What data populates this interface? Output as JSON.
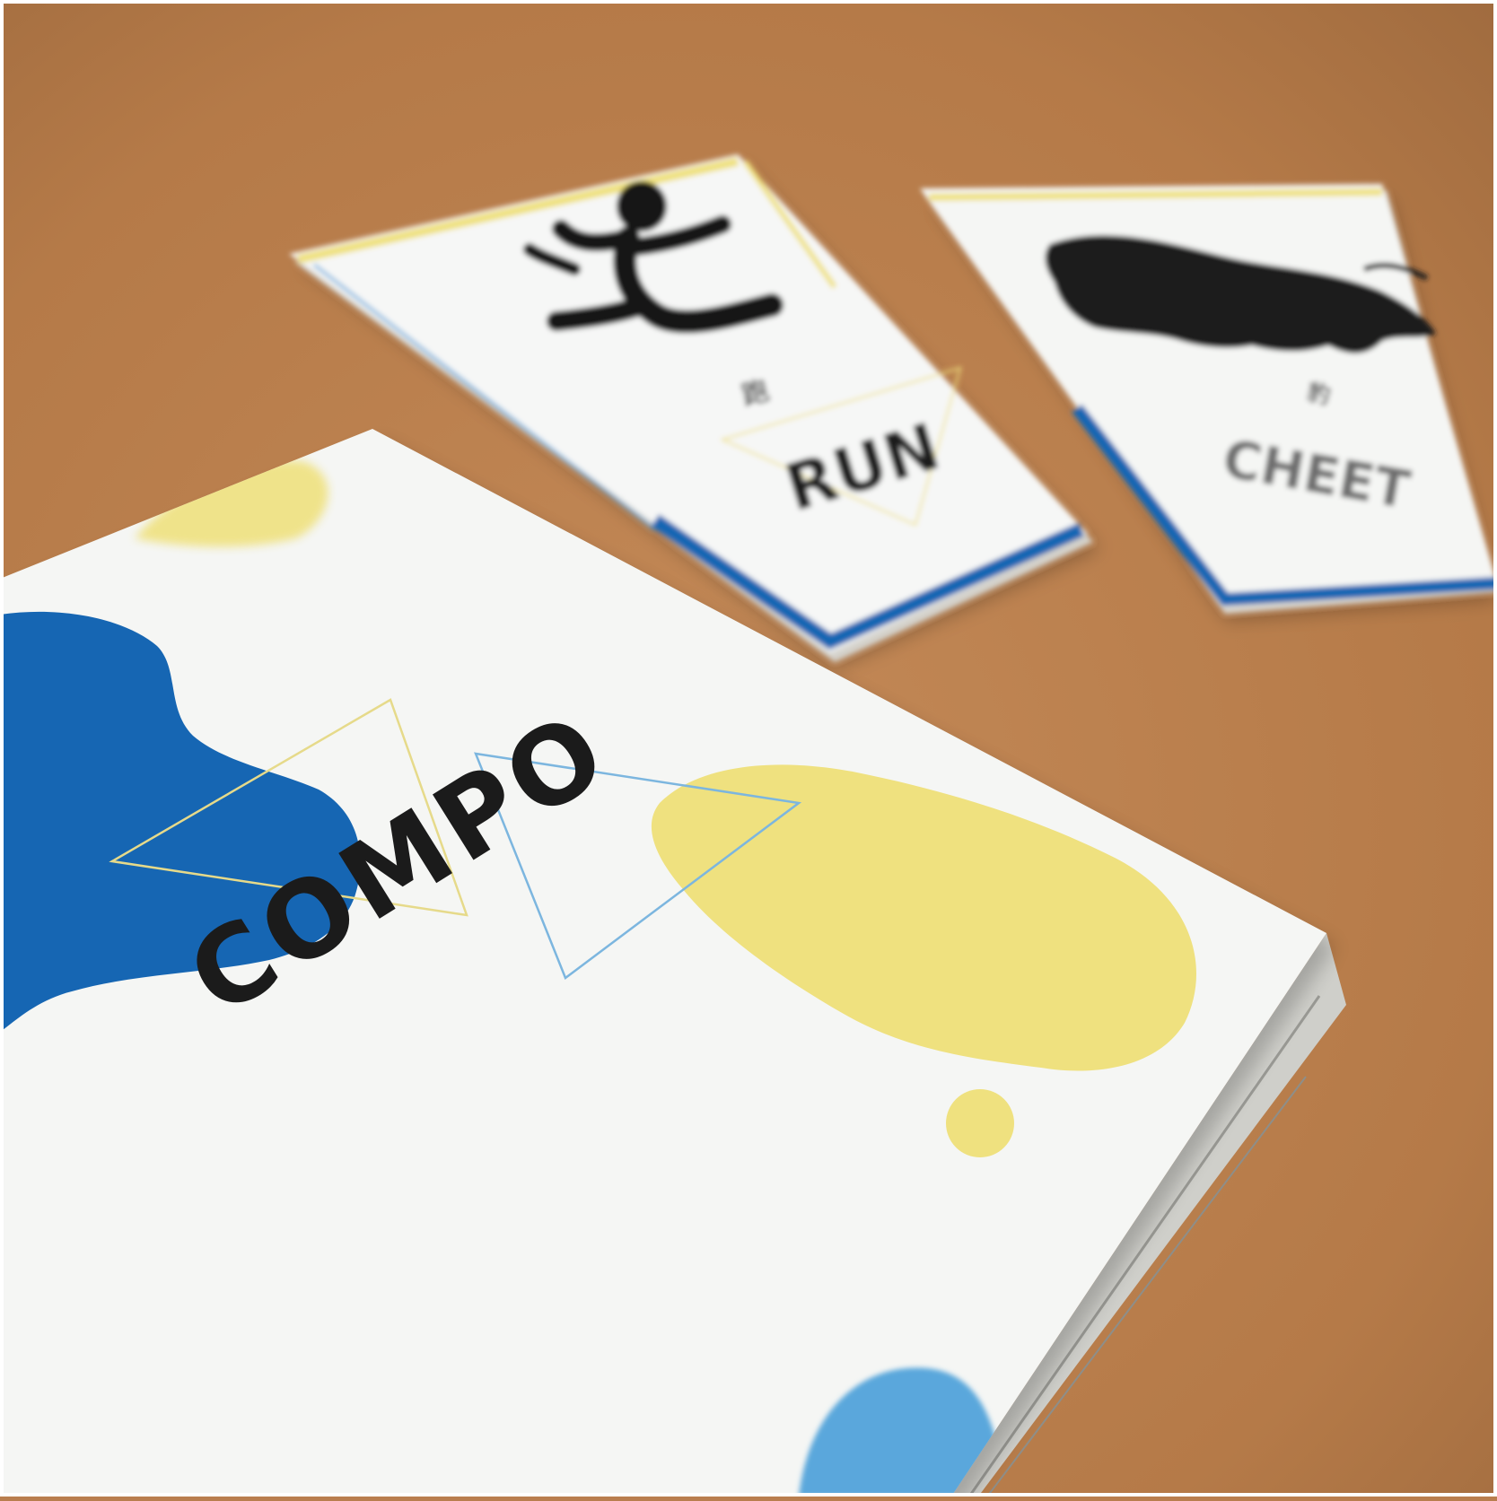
{
  "colors": {
    "table": "#b97e4e",
    "card": "#f6f7f6",
    "blue": "#1666b3",
    "yellow": "#efe17f",
    "light_blue": "#5aa7dc",
    "ink": "#1b1b1b"
  },
  "cover_card": {
    "title": "COMPO"
  },
  "run_card": {
    "cjk_label": "跑",
    "label": "RUN",
    "icon": "running-person-icon"
  },
  "cheetah_card": {
    "cjk_label": "豹",
    "label": "CHEET",
    "icon": "cheetah-icon"
  }
}
